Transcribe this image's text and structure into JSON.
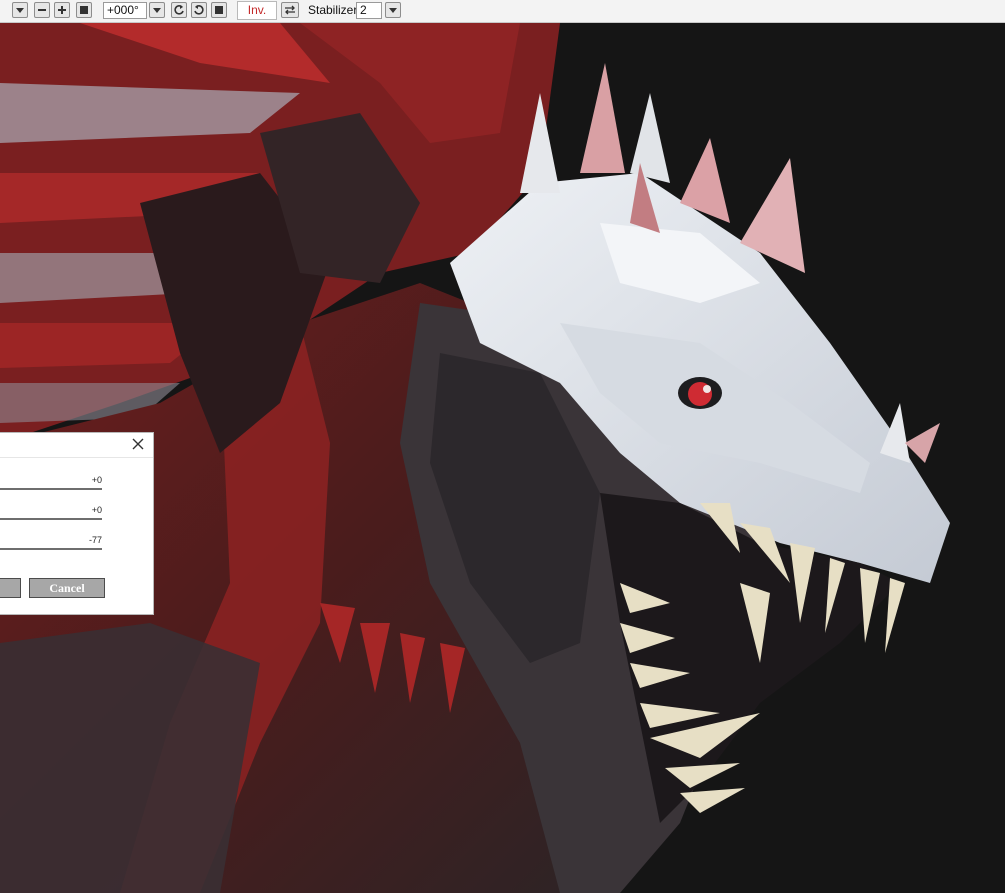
{
  "toolbar": {
    "angle_value": "+000°",
    "inv_label": "Inv.",
    "stabilizer_label": "Stabilizer",
    "stabilizer_value": "2",
    "icons": [
      "dropdown-icon",
      "zoom-out-icon",
      "zoom-in-icon",
      "fit-icon",
      "dropdown-icon",
      "rotate-left-icon",
      "rotate-right-icon",
      "reset-rotation-icon",
      "flip-icon",
      "dropdown-icon"
    ]
  },
  "dialog": {
    "sliders": [
      {
        "value": "+0"
      },
      {
        "value": "+0"
      },
      {
        "value": "-77"
      }
    ],
    "cancel_label": "Cancel"
  },
  "colors": {
    "toolbar_bg": "#f3f3f3",
    "canvas_bg": "#151515",
    "accent_red": "#c42a2a",
    "button_gray": "#a7a7a7"
  }
}
